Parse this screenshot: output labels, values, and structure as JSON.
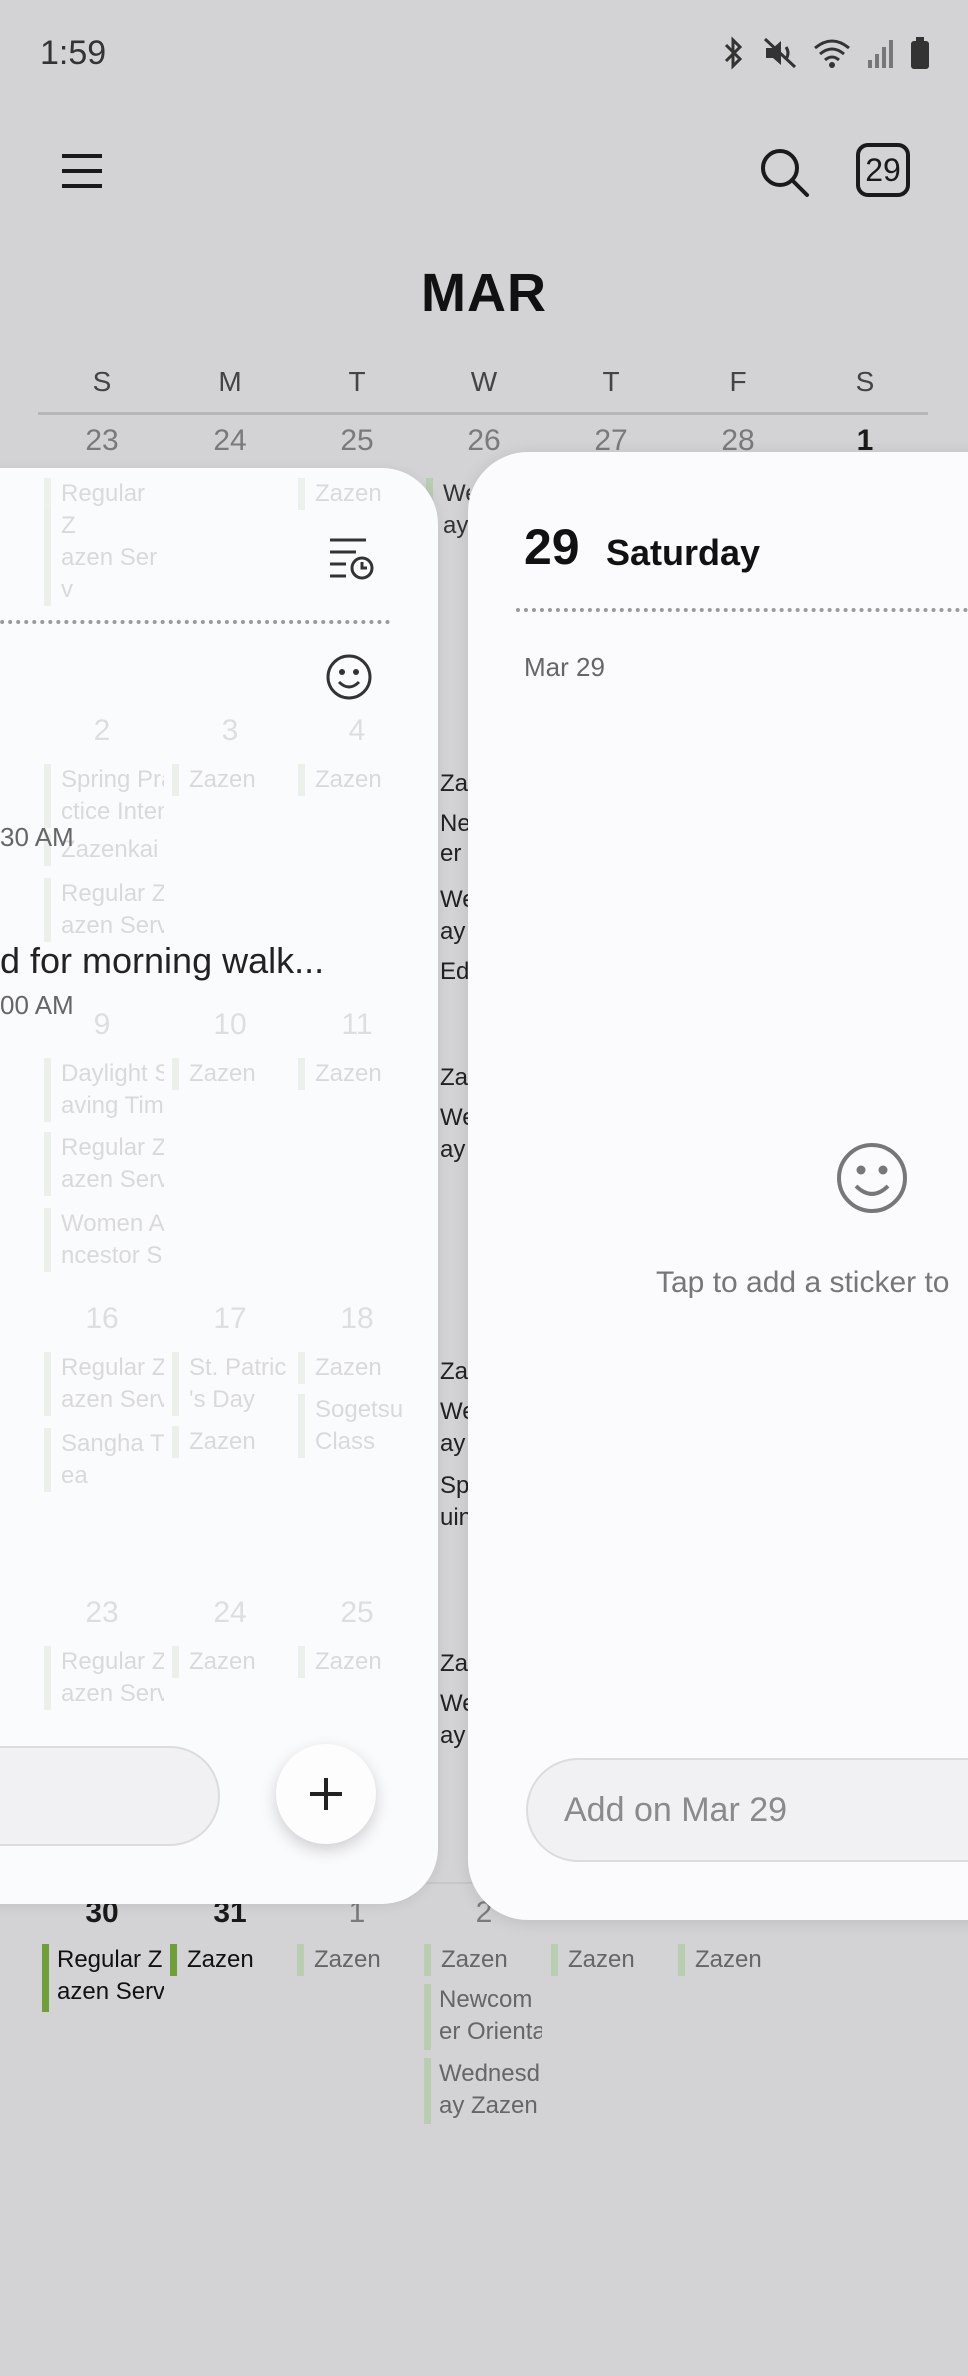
{
  "status": {
    "time": "1:59"
  },
  "header": {
    "today_badge": "29",
    "month": "MAR"
  },
  "weekdays": [
    "S",
    "M",
    "T",
    "W",
    "T",
    "F",
    "S"
  ],
  "grid": {
    "row1": [
      "23",
      "24",
      "25",
      "26",
      "27",
      "28",
      "1"
    ],
    "row2_events": {
      "col0": [
        "Regular Z",
        "azen Serv"
      ],
      "col2": [
        "Zazen"
      ],
      "col3": [
        "We",
        "ay"
      ]
    },
    "row3": [
      "2",
      "3",
      "4"
    ],
    "row3_events": {
      "col0a": [
        "Spring Pra",
        "ctice Inten"
      ],
      "col0b": "Zazenkai",
      "col0c": [
        "Regular Z",
        "azen Serv"
      ],
      "col1": "Zazen",
      "col2": "Zazen",
      "col3": [
        "Zaz",
        "New",
        "er C",
        "We",
        "ay",
        "Ede"
      ]
    },
    "row4": [
      "9",
      "10",
      "11"
    ],
    "row4_events": {
      "col0a": [
        "Daylight S",
        "aving Time"
      ],
      "col0b": [
        "Regular Z",
        "azen Serv"
      ],
      "col0c": [
        "Women A",
        "ncestor S"
      ],
      "col1": "Zazen",
      "col2": "Zazen",
      "col3": [
        "Zaz",
        "We",
        "ay"
      ]
    },
    "row5": [
      "16",
      "17",
      "18"
    ],
    "row5_events": {
      "col0a": [
        "Regular Z",
        "azen Serv"
      ],
      "col0b": [
        "Sangha T",
        "ea"
      ],
      "col1a": [
        "St. Patrick",
        "'s Day"
      ],
      "col1b": "Zazen",
      "col2a": "Zazen",
      "col2b": [
        "Sogetsu",
        "Class"
      ],
      "col3": [
        "Zaz",
        "We",
        "ay",
        "Spr",
        "uin"
      ]
    },
    "row6": [
      "23",
      "24",
      "25"
    ],
    "row6_events": {
      "col0": [
        "Regular Z",
        "azen Serv"
      ],
      "col1": "Zazen",
      "col2": "Zazen",
      "col3": [
        "Zaz",
        "We",
        "ay"
      ]
    },
    "row7": [
      "30",
      "31",
      "1",
      "2"
    ],
    "row7_events": {
      "col0": [
        "Regular Z",
        "azen Serv"
      ],
      "col1": "Zazen",
      "col2": "Zazen",
      "col3a": "Zazen",
      "col3b": [
        "Newcom",
        "er Orienta"
      ],
      "col3c": [
        "Wednesd",
        "ay Zazen S"
      ],
      "col4": "Zazen",
      "col5": "Zazen"
    }
  },
  "left_panel": {
    "time_a": "30 AM",
    "note": "d for morning walk...",
    "time_b": "00 AM"
  },
  "right_panel": {
    "day_number": "29",
    "day_name": "Saturday",
    "sub_date": "Mar 29",
    "sticker_hint": "Tap to add a sticker to",
    "add_placeholder": "Add on Mar 29"
  }
}
